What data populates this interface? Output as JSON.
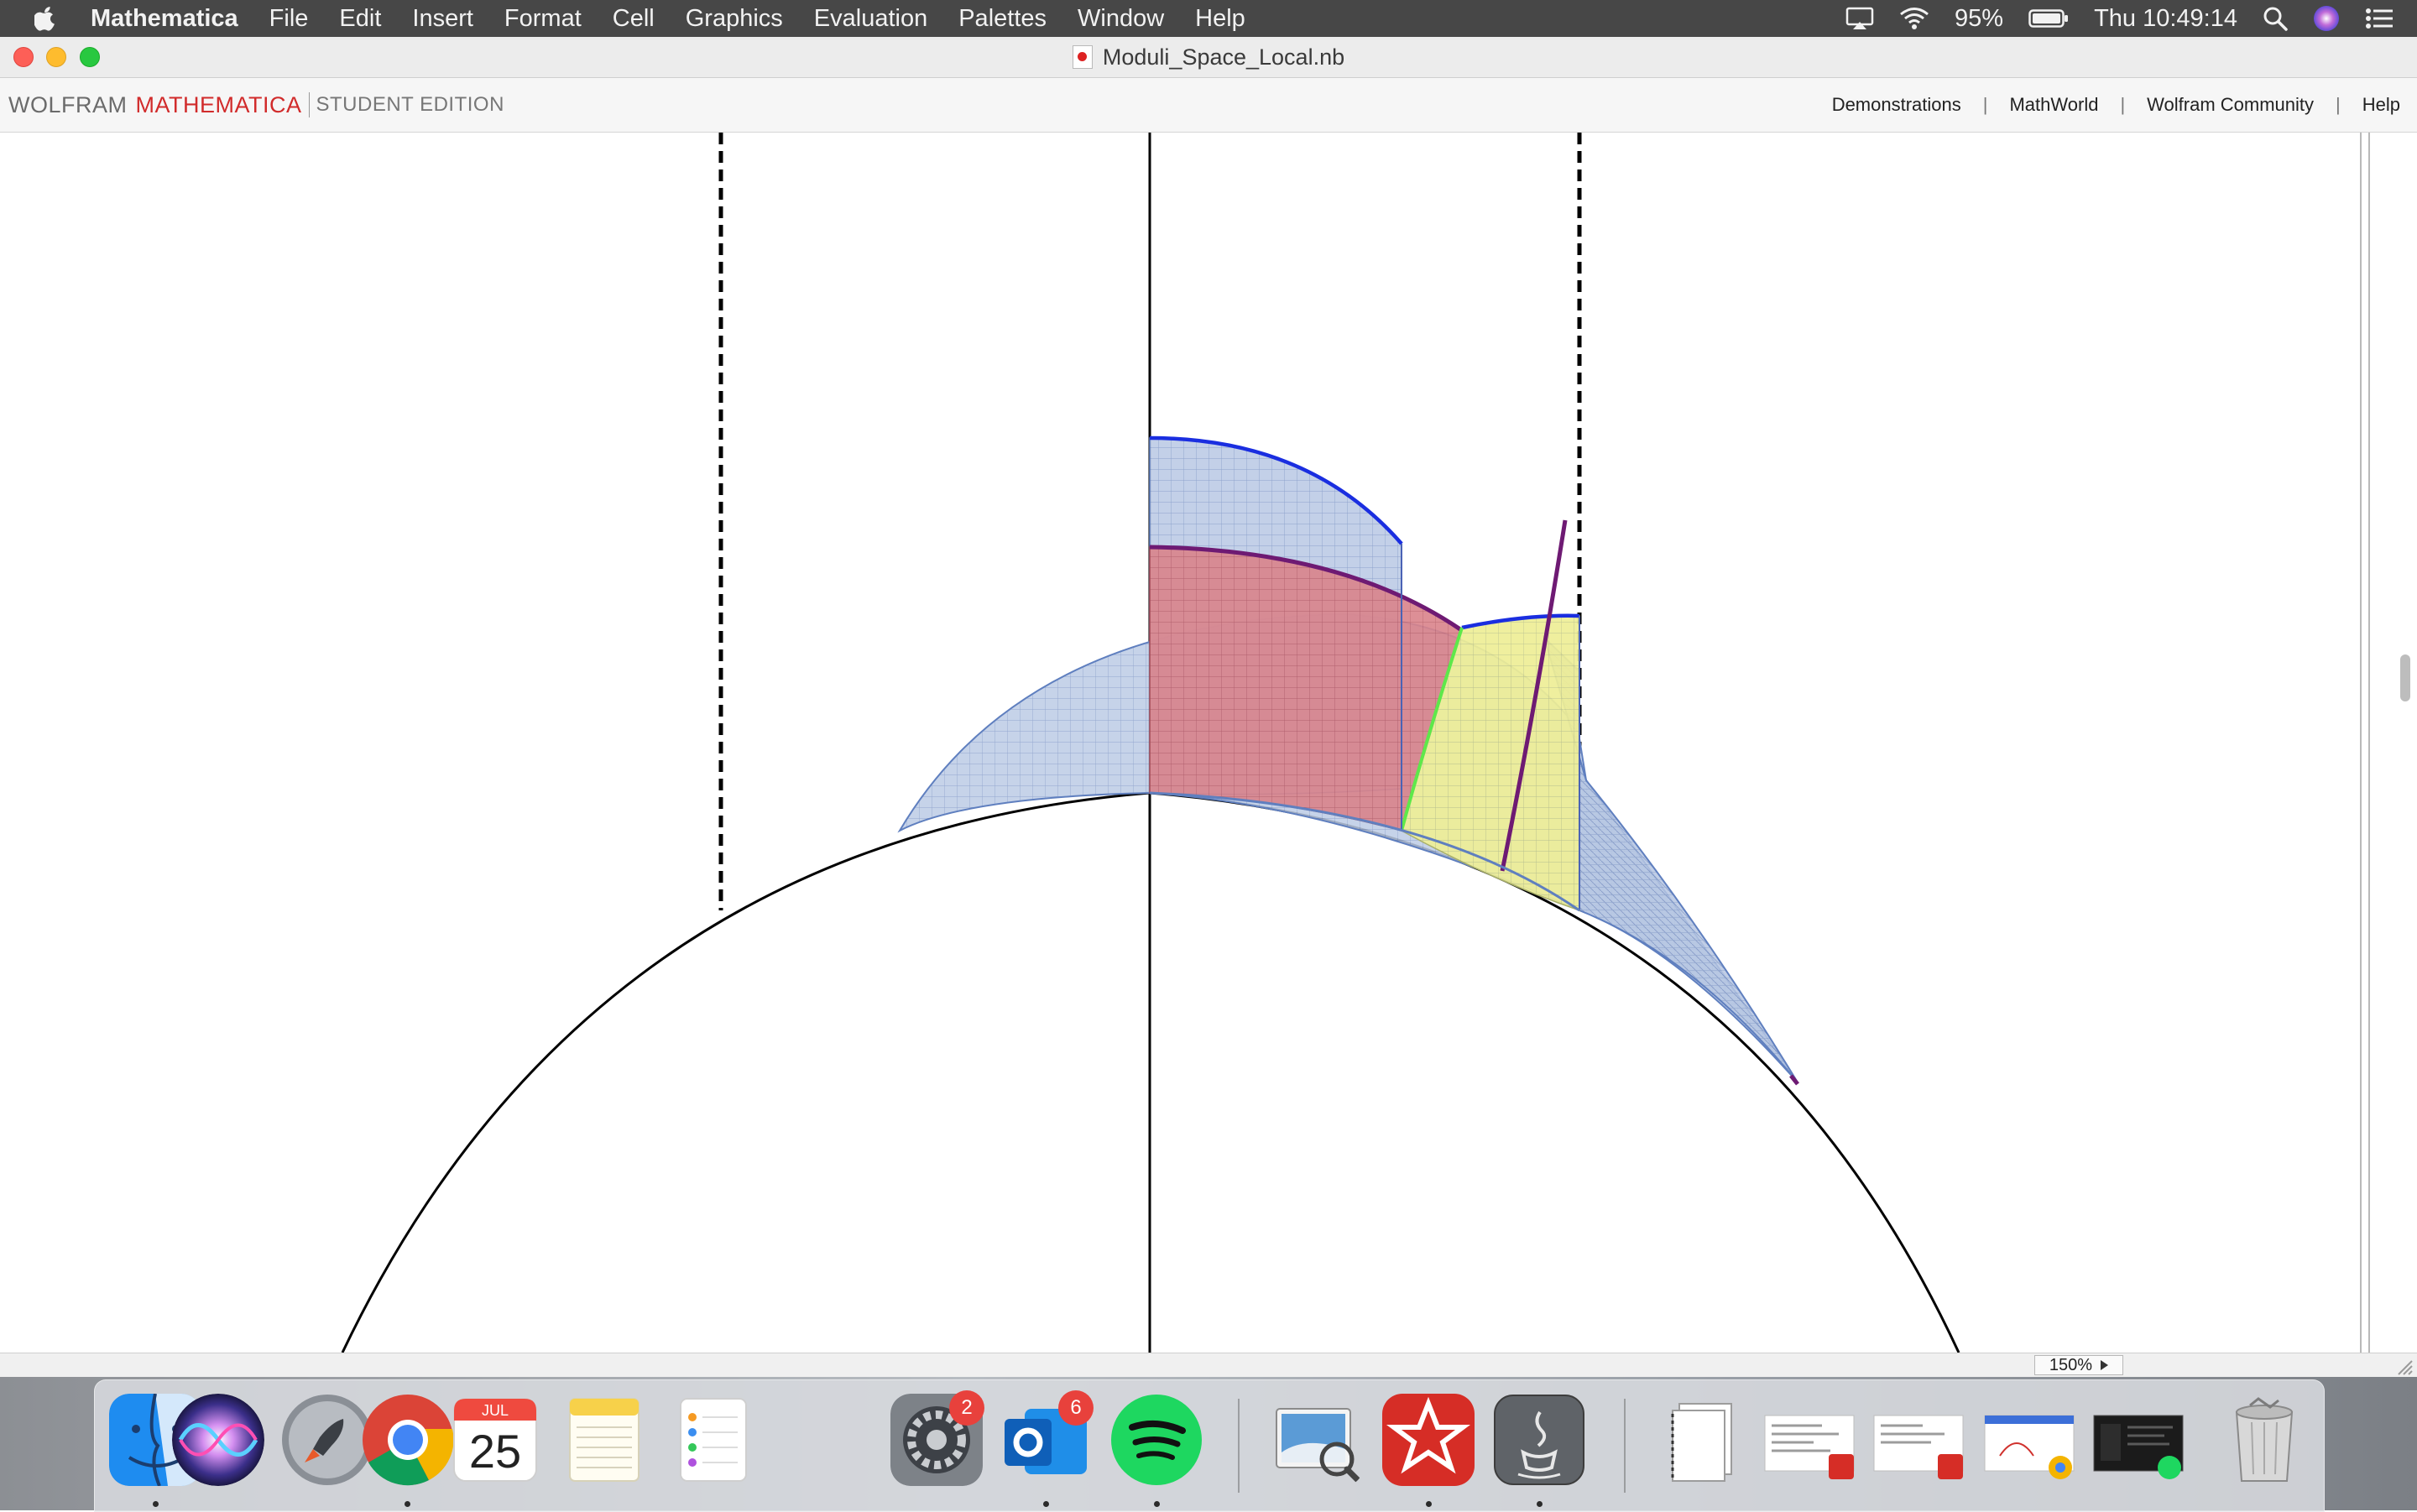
{
  "menubar": {
    "app_name": "Mathematica",
    "items": [
      "File",
      "Edit",
      "Insert",
      "Format",
      "Cell",
      "Graphics",
      "Evaluation",
      "Palettes",
      "Window",
      "Help"
    ],
    "battery": "95%",
    "clock": "Thu 10:49:14"
  },
  "window": {
    "title": "Moduli_Space_Local.nb"
  },
  "toolbar": {
    "brand_wolfram": "WOLFRAM",
    "brand_mathematica": "MATHEMATICA",
    "edition": "STUDENT EDITION",
    "links": [
      "Demonstrations",
      "MathWorld",
      "Wolfram Community",
      "Help"
    ]
  },
  "statusbar": {
    "zoom": "150%"
  },
  "dock": {
    "apps": [
      "Finder",
      "Siri",
      "Launchpad",
      "Google Chrome",
      "Calendar",
      "Notes",
      "Reminders",
      "System Preferences",
      "Microsoft Outlook",
      "Spotify",
      "Preview",
      "Wolfram Mathematica",
      "Java"
    ],
    "calendar_month": "JUL",
    "calendar_day": "25",
    "system_prefs_badge": "2",
    "outlook_badge": "6"
  },
  "colors": {
    "menubar_bg": "#474747",
    "brand_red": "#d12b2b",
    "region_blue": "#9fb4d9",
    "region_red": "#d9747c",
    "region_yellow": "#f5f28a",
    "boundary_blue": "#1a2ee0",
    "boundary_purple": "#6e1a73",
    "boundary_green": "#5ee84a"
  }
}
